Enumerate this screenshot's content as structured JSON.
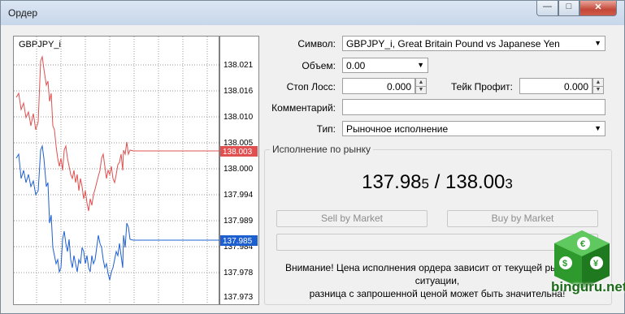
{
  "window": {
    "title": "Ордер",
    "buttons": {
      "minimize": "—",
      "maximize": "□",
      "close": "✕"
    }
  },
  "chart": {
    "symbol_label": "GBPJPY_i",
    "price_ticks": [
      "138.021",
      "138.016",
      "138.010",
      "138.005",
      "138.000",
      "137.994",
      "137.989",
      "137.984",
      "137.978",
      "137.973"
    ],
    "ask_tag": "138.003",
    "bid_tag": "137.985",
    "ask_color": "#e05050",
    "bid_color": "#1e5fd0"
  },
  "form": {
    "symbol": {
      "label": "Символ:",
      "value": "GBPJPY_i, Great Britain Pound vs Japanese Yen"
    },
    "volume": {
      "label": "Объем:",
      "value": "0.00"
    },
    "stop_loss": {
      "label": "Стоп Лосс:",
      "value": "0.000"
    },
    "take_profit": {
      "label": "Тейк Профит:",
      "value": "0.000"
    },
    "comment": {
      "label": "Комментарий:",
      "value": ""
    },
    "type": {
      "label": "Тип:",
      "value": "Рыночное исполнение"
    }
  },
  "execution": {
    "group_title": "Исполнение по рынку",
    "bid_main": "137.98",
    "bid_small": "5",
    "separator": " / ",
    "ask_main": "138.00",
    "ask_small": "3",
    "sell_label": "Sell by Market",
    "buy_label": "Buy by Market",
    "warning_line1": "Внимание! Цена исполнения ордера зависит от текущей рыночной ситуации,",
    "warning_line2": "разница с запрошенной ценой может быть значительна!"
  },
  "watermark": {
    "text": "binguru.net",
    "color": "#2e9a2e"
  }
}
